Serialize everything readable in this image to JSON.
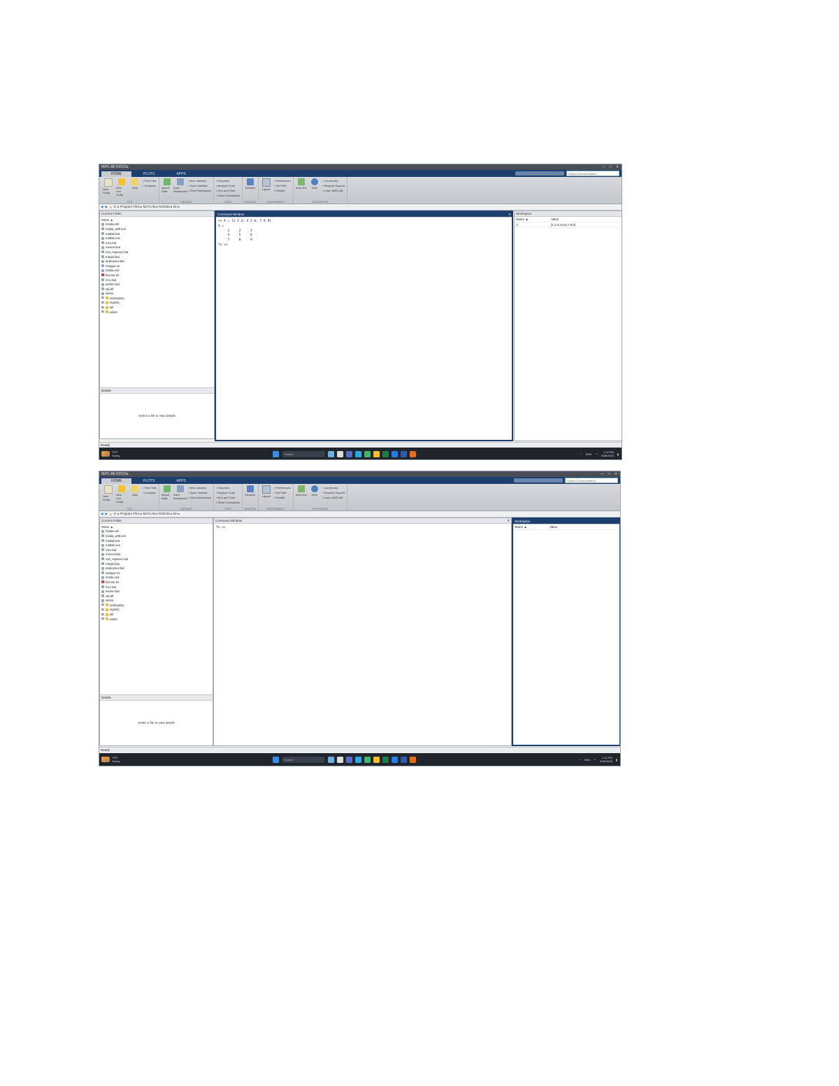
{
  "window": {
    "title": "MATLAB R2023a",
    "controls": [
      "—",
      "□",
      "✕"
    ]
  },
  "tabs": [
    "HOME",
    "PLOTS",
    "APPS"
  ],
  "search_placeholder": "Search Documentation",
  "ribbon": {
    "file": {
      "buttons": [
        "New Script",
        "New Live Script",
        "New",
        "Open"
      ],
      "small": [
        "Find Files",
        "Compare"
      ],
      "group": "FILE"
    },
    "variable": {
      "buttons": [
        "Import Data",
        "Save Workspace"
      ],
      "small": [
        "New Variable",
        "Open Variable",
        "Clear Workspace"
      ],
      "group": "VARIABLE"
    },
    "code": {
      "small": [
        "Favorites",
        "Analyze Code",
        "Run and Time",
        "Clear Commands"
      ],
      "group": "CODE"
    },
    "simulink": {
      "buttons": [
        "Simulink"
      ],
      "group": "SIMULINK"
    },
    "environment": {
      "buttons": [
        "Layout"
      ],
      "small": [
        "Preferences",
        "Set Path",
        "Parallel"
      ],
      "group": "ENVIRONMENT"
    },
    "resources": {
      "buttons": [
        "Add-Ons",
        "Help"
      ],
      "small": [
        "Community",
        "Request Support",
        "Learn MATLAB"
      ],
      "group": "RESOURCES"
    }
  },
  "address": "C: ▸ Program Files ▸ MATLAB ▸ R2023a ▸ bin ▸",
  "current_folder": {
    "title": "Current Folder",
    "name_header": "Name ▲",
    "files": [
      "lcdata.xml",
      "lcdata_utf8.xml",
      "matlab.bat",
      "matlab.exe",
      "mex.bat",
      "mexext.bat",
      "mw_mpiexec.bat",
      "mbuild.bat",
      "deploytool.bat",
      "insttype.ini",
      "lcdata.xsd",
      "license.txt",
      "mcc.bat",
      "worker.bat",
      "util.dll",
      "win64"
    ],
    "folders": [
      "m3iregistry",
      "registry",
      "util",
      "win64"
    ],
    "details_title": "Details",
    "details_text": "Select a file to view details"
  },
  "command_window": {
    "title": "Command Window",
    "shot1_lines": [
      ">> A = [1 2 3; 4 5 6; 7 8 9]",
      "",
      "A =",
      "",
      "     1     2     3",
      "     4     5     6",
      "     7     8     9",
      "",
      "fx >> "
    ],
    "shot2_lines": [
      "fx >> "
    ]
  },
  "workspace": {
    "title": "Workspace",
    "headers": [
      "Name ▲",
      "Value"
    ],
    "rows": [
      {
        "name": "A",
        "value": "[1,2,3;4,5,6;7,8,9]"
      }
    ]
  },
  "status": "Ready",
  "taskbar": {
    "weather_temp": "73°F",
    "weather_desc": "Sunny",
    "search": "Search",
    "tray": "ENG",
    "time": "1:12 PM",
    "date": "9/26/2023"
  }
}
